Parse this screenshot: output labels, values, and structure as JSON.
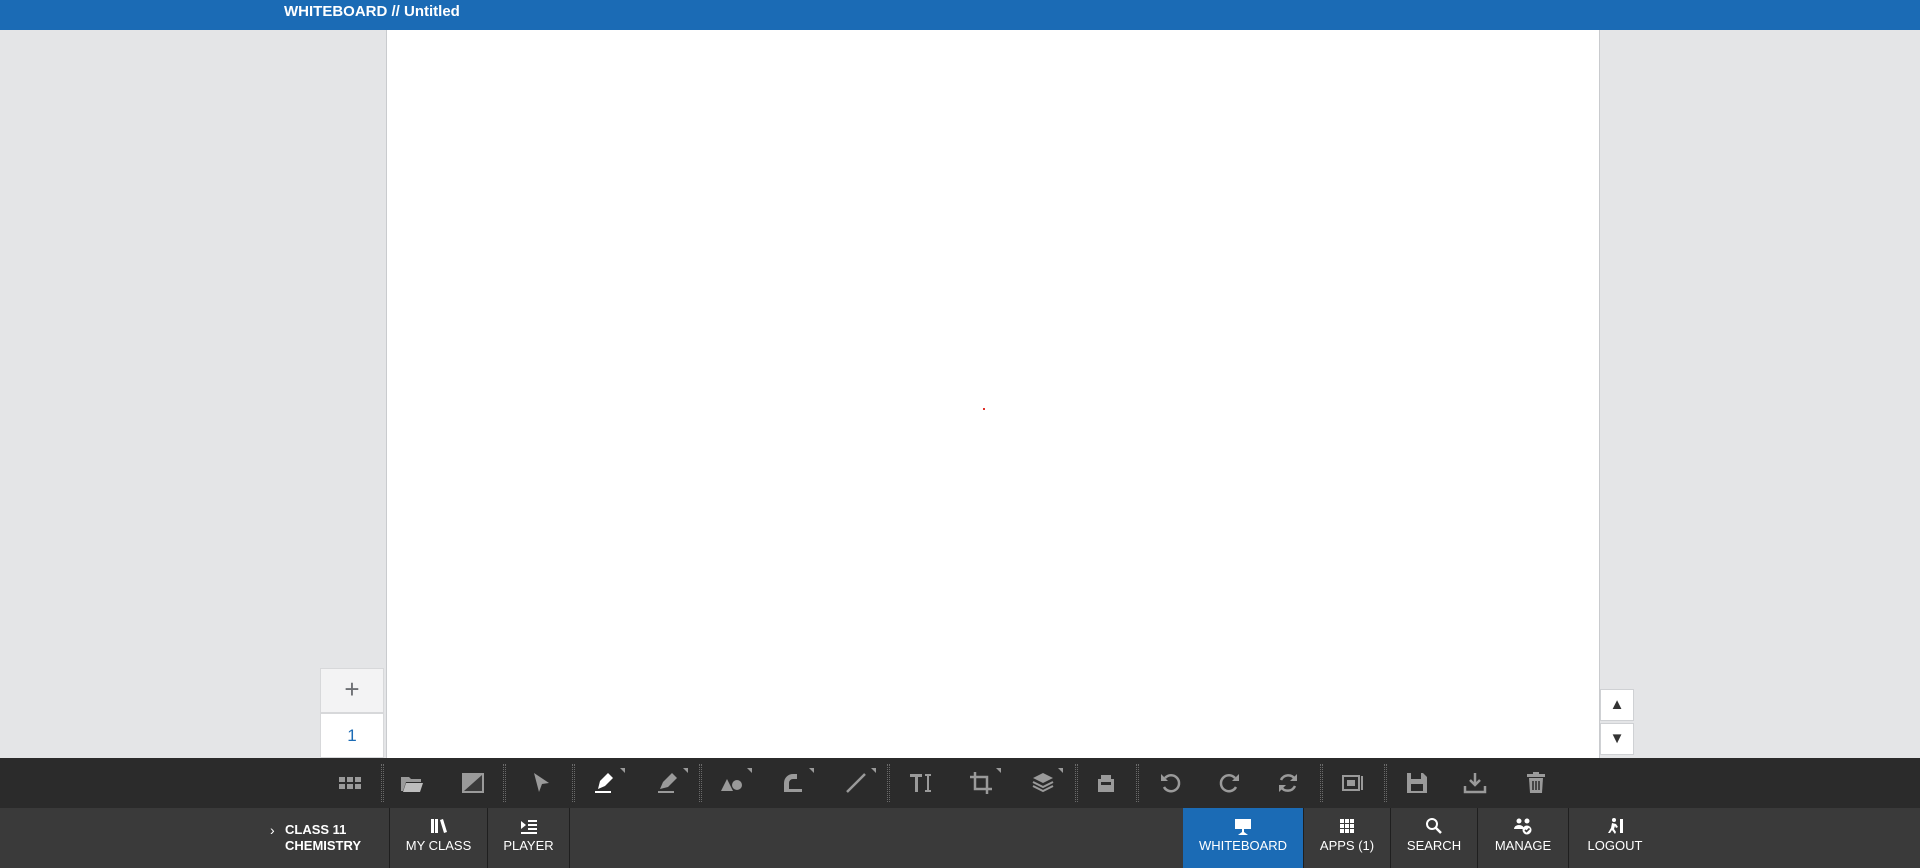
{
  "titlebar": {
    "title": "WHITEBOARD // Untitled"
  },
  "pages": {
    "add_label": "+",
    "items": [
      "1"
    ]
  },
  "scroll": {
    "up_label": "▲",
    "down_label": "▼"
  },
  "toolbar": {
    "tools": [
      {
        "name": "grid-view",
        "icon": "grid-icon"
      },
      {
        "name": "open-file",
        "icon": "folder-open-icon"
      },
      {
        "name": "background",
        "icon": "background-icon"
      },
      {
        "name": "select",
        "icon": "cursor-icon"
      },
      {
        "name": "pen",
        "icon": "pen-icon"
      },
      {
        "name": "highlighter",
        "icon": "highlighter-icon"
      },
      {
        "name": "shapes",
        "icon": "shapes-icon"
      },
      {
        "name": "geometry",
        "icon": "protractor-icon"
      },
      {
        "name": "line",
        "icon": "line-icon"
      },
      {
        "name": "text",
        "icon": "text-icon"
      },
      {
        "name": "crop",
        "icon": "crop-icon"
      },
      {
        "name": "layers",
        "icon": "layers-icon"
      },
      {
        "name": "eraser",
        "icon": "eraser-icon"
      },
      {
        "name": "undo",
        "icon": "undo-icon"
      },
      {
        "name": "redo",
        "icon": "redo-icon"
      },
      {
        "name": "refresh",
        "icon": "refresh-icon"
      },
      {
        "name": "screen-mode",
        "icon": "screen-icon"
      },
      {
        "name": "save",
        "icon": "save-icon"
      },
      {
        "name": "download",
        "icon": "download-icon"
      },
      {
        "name": "delete",
        "icon": "trash-icon"
      }
    ]
  },
  "nav": {
    "class_line1": "CLASS 11",
    "class_line2": "CHEMISTRY",
    "my_class": "MY CLASS",
    "player": "PLAYER",
    "whiteboard": "WHITEBOARD",
    "apps": "APPS (1)",
    "search": "SEARCH",
    "manage": "MANAGE",
    "logout": "LOGOUT"
  },
  "colors": {
    "accent": "#1b6bb5",
    "toolbar_bg": "#2b2b2b",
    "nav_bg": "#3a3a3a",
    "workspace_bg": "#e4e5e7"
  }
}
